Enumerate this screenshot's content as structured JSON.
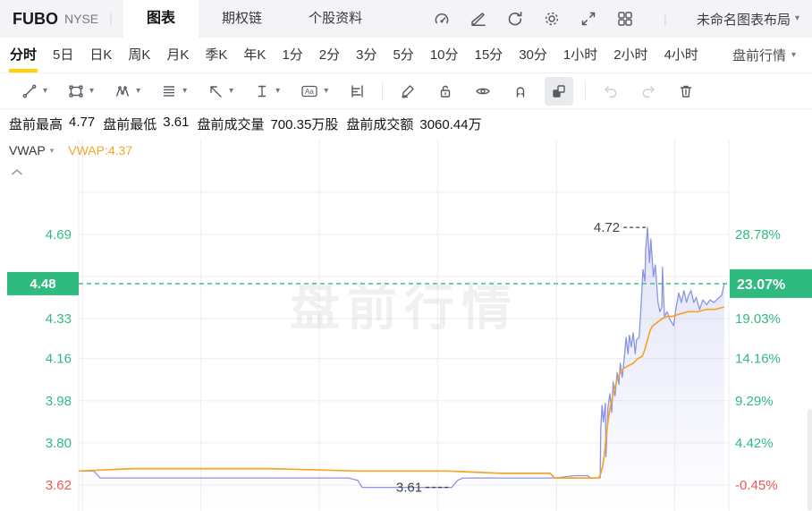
{
  "header": {
    "symbol": "FUBO",
    "exchange": "NYSE",
    "divider": "|",
    "tabs": [
      {
        "label": "图表",
        "active": true
      },
      {
        "label": "期权链",
        "active": false
      },
      {
        "label": "个股资料",
        "active": false
      }
    ],
    "icons": [
      "gauge-icon",
      "edit-icon",
      "refresh-icon",
      "settings-icon",
      "fullscreen-icon",
      "grid-layout-icon"
    ],
    "layout_name": "未命名图表布局"
  },
  "timeframe_bar": {
    "items": [
      "分时",
      "5日",
      "日K",
      "周K",
      "月K",
      "季K",
      "年K",
      "1分",
      "2分",
      "3分",
      "5分",
      "10分",
      "15分",
      "30分",
      "1小时",
      "2小时",
      "4小时"
    ],
    "active_index": 0,
    "session_label": "盘前行情"
  },
  "toolbar": {
    "tools": [
      "trendline-icon",
      "rectangle-icon",
      "pattern-icon",
      "fib-lines-icon",
      "arrow-icon",
      "measure-icon",
      "text-icon",
      "volume-profile-icon",
      "draw-icon",
      "unlock-icon",
      "eye-icon",
      "magnet-icon",
      "sync-drawings-icon",
      "undo-icon",
      "redo-icon",
      "trash-icon"
    ],
    "active_tool": "sync-drawings-icon"
  },
  "stats": {
    "items": [
      {
        "label": "盘前最高",
        "value": "4.77"
      },
      {
        "label": "盘前最低",
        "value": "3.61"
      },
      {
        "label": "盘前成交量",
        "value": "700.35万股"
      },
      {
        "label": "盘前成交额",
        "value": "3060.44万"
      }
    ]
  },
  "indicator_row": {
    "name": "VWAP",
    "value": "VWAP:4.37"
  },
  "chart_data": {
    "type": "line",
    "session": "盘前行情",
    "watermark": "盘前行情",
    "pre_market_high": 4.77,
    "pre_market_low": 3.61,
    "vwap_current": 4.37,
    "ylim": [
      3.509,
      5.095
    ],
    "grid_prices": [
      3.62,
      3.8,
      3.98,
      4.16,
      4.33,
      4.51,
      4.69,
      4.87
    ],
    "grid_x_fracs": [
      0.006,
      0.188,
      0.37,
      0.552,
      0.735,
      0.917
    ],
    "left_ticks": [
      {
        "price": 4.69,
        "label": "4.69",
        "negative": false
      },
      {
        "price": 4.33,
        "label": "4.33",
        "negative": false
      },
      {
        "price": 4.16,
        "label": "4.16",
        "negative": false
      },
      {
        "price": 3.98,
        "label": "3.98",
        "negative": false
      },
      {
        "price": 3.8,
        "label": "3.80",
        "negative": false
      },
      {
        "price": 3.62,
        "label": "3.62",
        "negative": true
      }
    ],
    "right_ticks": [
      {
        "price": 4.69,
        "label": "28.78%",
        "negative": false
      },
      {
        "price": 4.33,
        "label": "19.03%",
        "negative": false
      },
      {
        "price": 4.16,
        "label": "14.16%",
        "negative": false
      },
      {
        "price": 3.98,
        "label": "9.29%",
        "negative": false
      },
      {
        "price": 3.8,
        "label": "4.42%",
        "negative": false
      },
      {
        "price": 3.62,
        "label": "-0.45%",
        "negative": true
      }
    ],
    "current": {
      "price": 4.48,
      "price_label": "4.48",
      "pct_label": "23.07%"
    },
    "annotations": [
      {
        "label": "4.72",
        "t": 0.875,
        "price": 4.72
      },
      {
        "label": "3.61",
        "t": 0.571,
        "price": 3.61
      }
    ],
    "colors": {
      "up": "#2fbb7f",
      "down": "#f25555",
      "price_line": "#8b94e3",
      "vwap_line": "#f7a429",
      "grid": "#ededf0",
      "annotation": "#3f434a"
    },
    "series": [
      {
        "name": "price",
        "color": "#8b94e3",
        "fill": true,
        "points": [
          [
            0,
            3.68
          ],
          [
            0.023,
            3.68
          ],
          [
            0.033,
            3.65
          ],
          [
            0.415,
            3.65
          ],
          [
            0.429,
            3.64
          ],
          [
            0.436,
            3.61
          ],
          [
            0.574,
            3.61
          ],
          [
            0.583,
            3.64
          ],
          [
            0.591,
            3.65
          ],
          [
            0.723,
            3.65
          ],
          [
            0.732,
            3.65
          ],
          [
            0.763,
            3.66
          ],
          [
            0.783,
            3.66
          ],
          [
            0.787,
            3.65
          ],
          [
            0.802,
            3.65
          ],
          [
            0.803,
            3.86
          ],
          [
            0.805,
            3.96
          ],
          [
            0.807,
            3.89
          ],
          [
            0.81,
            3.97
          ],
          [
            0.811,
            3.74
          ],
          [
            0.814,
            3.95
          ],
          [
            0.817,
            4.01
          ],
          [
            0.82,
            3.93
          ],
          [
            0.822,
            4.06
          ],
          [
            0.825,
            4.0
          ],
          [
            0.828,
            4.1
          ],
          [
            0.831,
            4.05
          ],
          [
            0.833,
            4.14
          ],
          [
            0.836,
            4.08
          ],
          [
            0.839,
            4.16
          ],
          [
            0.842,
            4.25
          ],
          [
            0.845,
            4.18
          ],
          [
            0.847,
            4.26
          ],
          [
            0.85,
            4.21
          ],
          [
            0.853,
            4.27
          ],
          [
            0.856,
            4.18
          ],
          [
            0.858,
            4.24
          ],
          [
            0.862,
            4.25
          ],
          [
            0.865,
            4.39
          ],
          [
            0.868,
            4.54
          ],
          [
            0.871,
            4.49
          ],
          [
            0.872,
            4.62
          ],
          [
            0.875,
            4.72
          ],
          [
            0.878,
            4.57
          ],
          [
            0.88,
            4.67
          ],
          [
            0.884,
            4.51
          ],
          [
            0.887,
            4.56
          ],
          [
            0.891,
            4.4
          ],
          [
            0.894,
            4.36
          ],
          [
            0.897,
            4.38
          ],
          [
            0.898,
            4.55
          ],
          [
            0.901,
            4.34
          ],
          [
            0.905,
            4.36
          ],
          [
            0.909,
            4.33
          ],
          [
            0.915,
            4.3
          ],
          [
            0.919,
            4.38
          ],
          [
            0.923,
            4.44
          ],
          [
            0.927,
            4.4
          ],
          [
            0.931,
            4.45
          ],
          [
            0.935,
            4.4
          ],
          [
            0.938,
            4.43
          ],
          [
            0.942,
            4.45
          ],
          [
            0.946,
            4.4
          ],
          [
            0.95,
            4.42
          ],
          [
            0.955,
            4.37
          ],
          [
            0.96,
            4.41
          ],
          [
            0.966,
            4.39
          ],
          [
            0.971,
            4.41
          ],
          [
            0.977,
            4.4
          ],
          [
            0.981,
            4.41
          ],
          [
            0.985,
            4.42
          ],
          [
            0.989,
            4.43
          ],
          [
            0.993,
            4.48
          ]
        ]
      },
      {
        "name": "vwap",
        "color": "#f7a429",
        "fill": false,
        "points": [
          [
            0,
            3.68
          ],
          [
            0.085,
            3.69
          ],
          [
            0.292,
            3.69
          ],
          [
            0.429,
            3.68
          ],
          [
            0.567,
            3.68
          ],
          [
            0.649,
            3.67
          ],
          [
            0.725,
            3.67
          ],
          [
            0.732,
            3.65
          ],
          [
            0.8,
            3.65
          ],
          [
            0.803,
            3.67
          ],
          [
            0.806,
            3.7
          ],
          [
            0.809,
            3.76
          ],
          [
            0.811,
            3.82
          ],
          [
            0.814,
            3.89
          ],
          [
            0.818,
            3.96
          ],
          [
            0.824,
            4.03
          ],
          [
            0.828,
            4.07
          ],
          [
            0.833,
            4.1
          ],
          [
            0.839,
            4.12
          ],
          [
            0.846,
            4.13
          ],
          [
            0.853,
            4.14
          ],
          [
            0.86,
            4.16
          ],
          [
            0.867,
            4.17
          ],
          [
            0.871,
            4.2
          ],
          [
            0.875,
            4.24
          ],
          [
            0.879,
            4.28
          ],
          [
            0.883,
            4.3
          ],
          [
            0.888,
            4.31
          ],
          [
            0.897,
            4.33
          ],
          [
            0.905,
            4.34
          ],
          [
            0.913,
            4.34
          ],
          [
            0.924,
            4.35
          ],
          [
            0.938,
            4.36
          ],
          [
            0.952,
            4.36
          ],
          [
            0.966,
            4.37
          ],
          [
            0.979,
            4.37
          ],
          [
            0.993,
            4.38
          ]
        ]
      }
    ]
  }
}
